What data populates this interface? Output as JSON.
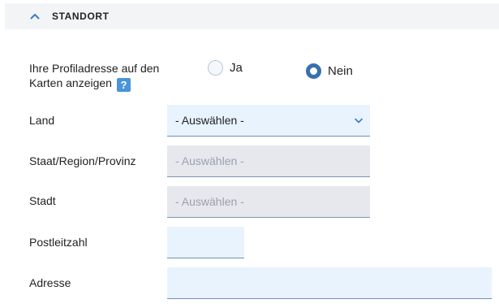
{
  "section": {
    "title": "STANDORT",
    "collapse_icon": "chevron-up-icon"
  },
  "show_address": {
    "label_line1": "Ihre Profiladresse auf den",
    "label_line2": "Karten anzeigen",
    "help_text": "?",
    "options": [
      {
        "label": "Ja",
        "selected": false
      },
      {
        "label": "Nein",
        "selected": true
      }
    ]
  },
  "fields": {
    "country": {
      "label": "Land",
      "value": "- Auswählen -"
    },
    "region": {
      "label": "Staat/Region/Provinz",
      "placeholder": "- Auswählen -"
    },
    "city": {
      "label": "Stadt",
      "placeholder": "- Auswählen -"
    },
    "zip": {
      "label": "Postleitzahl",
      "value": ""
    },
    "address": {
      "label": "Adresse",
      "value": ""
    }
  },
  "colors": {
    "accent": "#3a6fae",
    "help_badge": "#4a94d8",
    "field_active": "#e8f3fe",
    "field_disabled": "#e6e8ee"
  }
}
